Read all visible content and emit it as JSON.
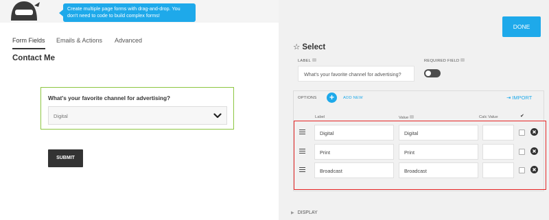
{
  "tooltip": {
    "line1": "Create multiple page forms with drag-and-drop. You",
    "line2": "don't need to code to build complex forms!"
  },
  "tabs": [
    {
      "label": "Form Fields",
      "active": true
    },
    {
      "label": "Emails & Actions",
      "active": false
    },
    {
      "label": "Advanced",
      "active": false
    }
  ],
  "form": {
    "title": "Contact Me",
    "field_label": "What's your favorite channel for advertising?",
    "select_value": "Digital",
    "submit_label": "SUBMIT"
  },
  "drawer": {
    "done_label": "DONE",
    "title": "Select",
    "label_caption": "LABEL",
    "label_value": "What's your favorite channel for advertising?",
    "required_caption": "REQUIRED FIELD",
    "required_on": false,
    "options_caption": "OPTIONS",
    "add_new": "ADD NEW",
    "import": "IMPORT",
    "columns": {
      "label": "Label",
      "value": "Value",
      "calc": "Calc Value",
      "check": "✔"
    },
    "options": [
      {
        "label": "Digital",
        "value": "Digital",
        "calc": "",
        "checked": false
      },
      {
        "label": "Print",
        "value": "Print",
        "calc": "",
        "checked": false
      },
      {
        "label": "Broadcast",
        "value": "Broadcast",
        "calc": "",
        "checked": false
      }
    ],
    "display": "DISPLAY"
  },
  "colors": {
    "accent": "#1ea9ea",
    "field_border": "#8cc63f",
    "highlight": "#e52323",
    "submit": "#333333"
  },
  "icons": [
    "ninja-mascot-icon",
    "star-icon",
    "help-bubble-icon",
    "plus-icon",
    "import-icon",
    "drag-handle-icon",
    "remove-icon",
    "chevron-down-icon",
    "caret-right-icon"
  ]
}
